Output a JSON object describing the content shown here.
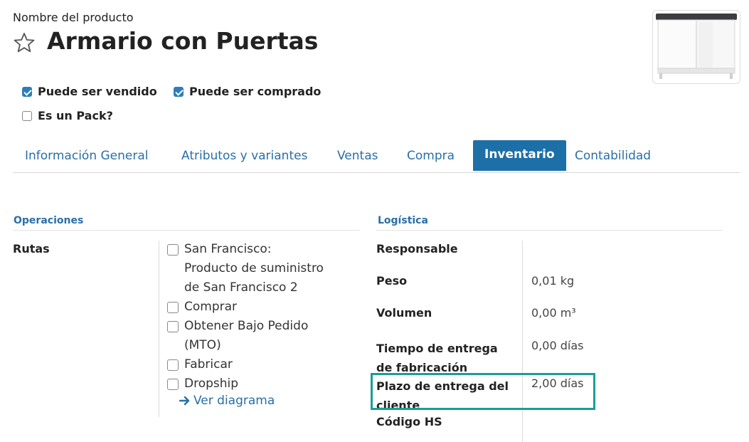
{
  "header": {
    "product_label": "Nombre del producto",
    "product_name": "Armario con Puertas"
  },
  "checkboxes": {
    "can_be_sold": {
      "label": "Puede ser vendido",
      "checked": true
    },
    "can_be_purchased": {
      "label": "Puede ser comprado",
      "checked": true
    },
    "is_pack": {
      "label": "Es un Pack?",
      "checked": false
    }
  },
  "tabs": [
    {
      "label": "Información General",
      "active": false
    },
    {
      "label": "Atributos y variantes",
      "active": false
    },
    {
      "label": "Ventas",
      "active": false
    },
    {
      "label": "Compra",
      "active": false
    },
    {
      "label": "Inventario",
      "active": true
    },
    {
      "label": "Contabilidad",
      "active": false
    }
  ],
  "operations": {
    "title": "Operaciones",
    "routes_label": "Rutas",
    "routes": [
      {
        "lines": [
          "San Francisco:",
          "Producto de suministro",
          "de San Francisco 2"
        ],
        "checked": false
      },
      {
        "lines": [
          "Comprar"
        ],
        "checked": false
      },
      {
        "lines": [
          "Obtener Bajo Pedido",
          "(MTO)"
        ],
        "checked": false
      },
      {
        "lines": [
          "Fabricar"
        ],
        "checked": false
      },
      {
        "lines": [
          "Dropship"
        ],
        "checked": false
      }
    ],
    "diagram_link": "Ver diagrama"
  },
  "logistics": {
    "title": "Logística",
    "responsible_label": "Responsable",
    "responsible_value": "",
    "weight_label": "Peso",
    "weight_value": "0,01 kg",
    "volume_label": "Volumen",
    "volume_value": "0,00  m³",
    "mfg_lead_label_1": "Tiempo de entrega",
    "mfg_lead_label_2": "de fabricación",
    "mfg_lead_value": "0,00 días",
    "customer_lead_label_1": "Plazo de entrega del",
    "customer_lead_label_2": "cliente",
    "customer_lead_value": "2,00 días",
    "hs_code_label": "Código HS",
    "hs_code_value": ""
  },
  "colors": {
    "accent": "#1d6fa8",
    "link": "#2a6fa6",
    "highlight": "#1a9e96"
  }
}
